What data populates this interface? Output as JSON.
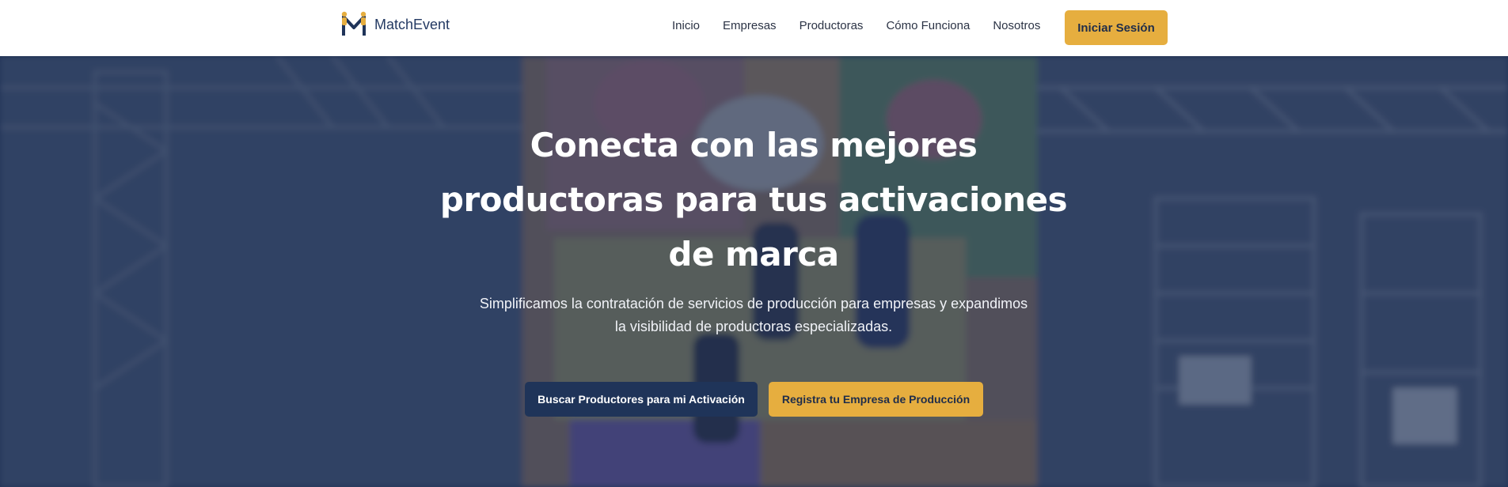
{
  "brand": {
    "name": "MatchEvent",
    "logo_icon": "two-people-holding-m-logo"
  },
  "nav": {
    "links": [
      "Inicio",
      "Empresas",
      "Productoras",
      "Cómo Funciona",
      "Nosotros"
    ],
    "login_label": "Iniciar Sesión"
  },
  "hero": {
    "background": "blurred photo of event climbing wall with stage trusses",
    "title": "Conecta con las mejores productoras para tus activaciones de marca",
    "subtitle": "Simplificamos la contratación de servicios de producción para empresas y expandimos la visibilidad de productoras especializadas.",
    "primary_cta": "Buscar Productores para mi Activación",
    "secondary_cta": "Registra tu Empresa de Producción"
  },
  "colors": {
    "accent": "#e6ae3f",
    "navy": "#1f3459",
    "overlay": "#1c2d52"
  }
}
